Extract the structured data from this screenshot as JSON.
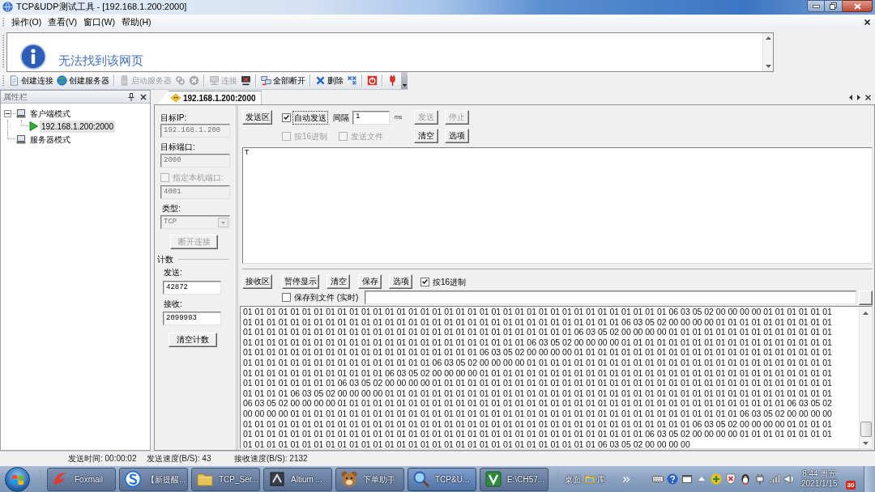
{
  "window": {
    "title": "TCP&UDP测试工具 - [192.168.1.200:2000]"
  },
  "menu": [
    "操作(O)",
    "查看(V)",
    "窗口(W)",
    "帮助(H)"
  ],
  "browser_panel": {
    "message": "无法找到该网页"
  },
  "toolbar": [
    {
      "kind": "button",
      "label": "创建连接",
      "disabled": false
    },
    {
      "kind": "button",
      "label": "创建服务器",
      "disabled": false
    },
    {
      "kind": "separator"
    },
    {
      "kind": "button",
      "label": "启动服务器",
      "disabled": true
    },
    {
      "kind": "icon_button",
      "disabled": true
    },
    {
      "kind": "icon_button",
      "disabled": true
    },
    {
      "kind": "separator"
    },
    {
      "kind": "button",
      "label": "连接",
      "disabled": true
    },
    {
      "kind": "icon_button",
      "disabled": false
    },
    {
      "kind": "separator"
    },
    {
      "kind": "button",
      "label": "全部断开",
      "disabled": false
    },
    {
      "kind": "separator"
    },
    {
      "kind": "button",
      "label": "删除",
      "disabled": false
    },
    {
      "kind": "icon_button",
      "disabled": false
    },
    {
      "kind": "separator"
    },
    {
      "kind": "icon_button",
      "disabled": false
    },
    {
      "kind": "separator"
    },
    {
      "kind": "icon_button",
      "disabled": false
    }
  ],
  "properties_panel": {
    "title": "属性栏",
    "tree": [
      {
        "label": "客户端模式",
        "selected": false,
        "expanded": true,
        "children": [
          {
            "label": "192.168.1.200:2000",
            "selected": true
          }
        ]
      },
      {
        "label": "服务器模式",
        "selected": false
      }
    ]
  },
  "tabs": [
    {
      "label": "192.168.1.200:2000",
      "selected": true
    }
  ],
  "connection": {
    "target_ip": {
      "label": "目标IP:",
      "value": "192.168.1.200",
      "disabled": true
    },
    "target_port": {
      "label": "目标端口:",
      "value": "2000",
      "disabled": true
    },
    "local_port": {
      "label": "指定本机端口:",
      "checked": false,
      "disabled": true,
      "value": "4001"
    },
    "type": {
      "label": "类型:",
      "value": "TCP",
      "disabled": true
    },
    "disconnect_button": {
      "label": "断开连接",
      "disabled": true
    }
  },
  "counter": {
    "title": "计数",
    "sent": {
      "label": "发送:",
      "value": "42872"
    },
    "received": {
      "label": "接收:",
      "value": "2099993"
    },
    "clear_button": "清空计数"
  },
  "send": {
    "area_button": "发送区",
    "auto_send": {
      "label": "自动发送",
      "checked": true,
      "focused": true
    },
    "interval": {
      "label": "间隔",
      "value": "1",
      "unit": "ms"
    },
    "hex": {
      "label": "按16进制",
      "checked": false,
      "disabled": true
    },
    "send_file": {
      "label": "发送文件",
      "checked": false,
      "disabled": true
    },
    "buttons": [
      {
        "label": "发送",
        "disabled": true
      },
      {
        "label": "停止",
        "disabled": true
      },
      {
        "label": "清空",
        "disabled": false
      },
      {
        "label": "选项",
        "disabled": false
      }
    ],
    "text": "T"
  },
  "receive": {
    "area_button": "接收区",
    "buttons": [
      "暂停显示",
      "清空",
      "保存",
      "选项"
    ],
    "hex": {
      "label": "按16进制",
      "checked": true
    },
    "save_to_file": {
      "label": "保存到文件 (实时)",
      "checked": false
    },
    "lines": [
      "01 01 01 01 01 01 01 01 01 01 01 01 01 01 01 01 01 01 01 01 01 01 01 01 01 01 01 01 01 01 01 01 01 01 01 01 06 03 05 02 00 00 00 00 01 01 01 01 01 01",
      "01 01 01 01 01 01 01 01 01 01 01 01 01 01 01 01 01 01 01 01 01 01 01 01 01 01 01 01 01 01 01 01 06 03 05 02 00 00 00 00 01 01 01 01 01 01 01 01 01 01",
      "01 01 01 01 01 01 01 01 01 01 01 01 01 01 01 01 01 01 01 01 01 01 01 01 01 01 01 01 06 03 05 02 00 00 00 00 01 01 01 01 01 01 01 01 01 01 01 01 01 01",
      "01 01 01 01 01 01 01 01 01 01 01 01 01 01 01 01 01 01 01 01 01 01 01 01 06 03 05 02 00 00 00 00 01 01 01 01 01 01 01 01 01 01 01 01 01 01 01 01 01 01",
      "01 01 01 01 01 01 01 01 01 01 01 01 01 01 01 01 01 01 01 01 06 03 05 02 00 00 00 00 01 01 01 01 01 01 01 01 01 01 01 01 01 01 01 01 01 01 01 01 01 01",
      "01 01 01 01 01 01 01 01 01 01 01 01 01 01 01 01 06 03 05 02 00 00 00 00 01 01 01 01 01 01 01 01 01 01 01 01 01 01 01 01 01 01 01 01 01 01 01 01 01 01",
      "01 01 01 01 01 01 01 01 01 01 01 01 06 03 05 02 00 00 00 00 01 01 01 01 01 01 01 01 01 01 01 01 01 01 01 01 01 01 01 01 01 01 01 01 01 01 01 01 01 01",
      "01 01 01 01 01 01 01 01 06 03 05 02 00 00 00 00 01 01 01 01 01 01 01 01 01 01 01 01 01 01 01 01 01 01 01 01 01 01 01 01 01 01 01 01 01 01 01 01 01 01",
      "01 01 01 01 06 03 05 02 00 00 00 00 01 01 01 01 01 01 01 01 01 01 01 01 01 01 01 01 01 01 01 01 01 01 01 01 01 01 01 01 01 01 01 01 01 01 01 01 01 01",
      "06 03 05 02 00 00 00 00 01 01 01 01 01 01 01 01 01 01 01 01 01 01 01 01 01 01 01 01 01 01 01 01 01 01 01 01 01 01 01 01 01 01 01 01 01 01 06 03 05 02",
      "00 00 00 00 01 01 01 01 01 01 01 01 01 01 01 01 01 01 01 01 01 01 01 01 01 01 01 01 01 01 01 01 01 01 01 01 01 01 01 01 01 01 06 03 05 02 00 00 00 00",
      "01 01 01 01 01 01 01 01 01 01 01 01 01 01 01 01 01 01 01 01 01 01 01 01 01 01 01 01 01 01 01 01 01 01 01 01 01 01 06 03 05 02 00 00 00 00 01 01 01 01",
      "01 01 01 01 01 01 01 01 01 01 01 01 01 01 01 01 01 01 01 01 01 01 01 01 01 01 01 01 01 01 01 01 01 01 06 03 05 02 00 00 00 00 01 01 01 01 01 01 01 01",
      "01 01 01 01 01 01 01 01 01 01 01 01 01 01 01 01 01 01 01 01 01 01 01 01 01 01 01 01 01 01 06 03 05 02 00 00 00 00"
    ]
  },
  "status_bar": [
    "发送时间: 00:00:02",
    "发送速度(B/S): 43",
    "接收速度(B/S): 2132"
  ],
  "taskbar": {
    "buttons": [
      {
        "label": "Foxmail",
        "selected": false
      },
      {
        "label": "【新提醒...",
        "selected": false
      },
      {
        "label": "TCP_Ser...",
        "selected": false
      },
      {
        "label": "Altium ...",
        "selected": false
      },
      {
        "label": "下单助手",
        "selected": false
      },
      {
        "label": "TCP&U...",
        "selected": true
      },
      {
        "label": "E:\\CH57...",
        "selected": false
      }
    ],
    "toolbar": [
      "桌面",
      "库"
    ],
    "clock": {
      "time": "8:44 周五",
      "date": "2021/1/15"
    },
    "calendar_badge": "30"
  }
}
